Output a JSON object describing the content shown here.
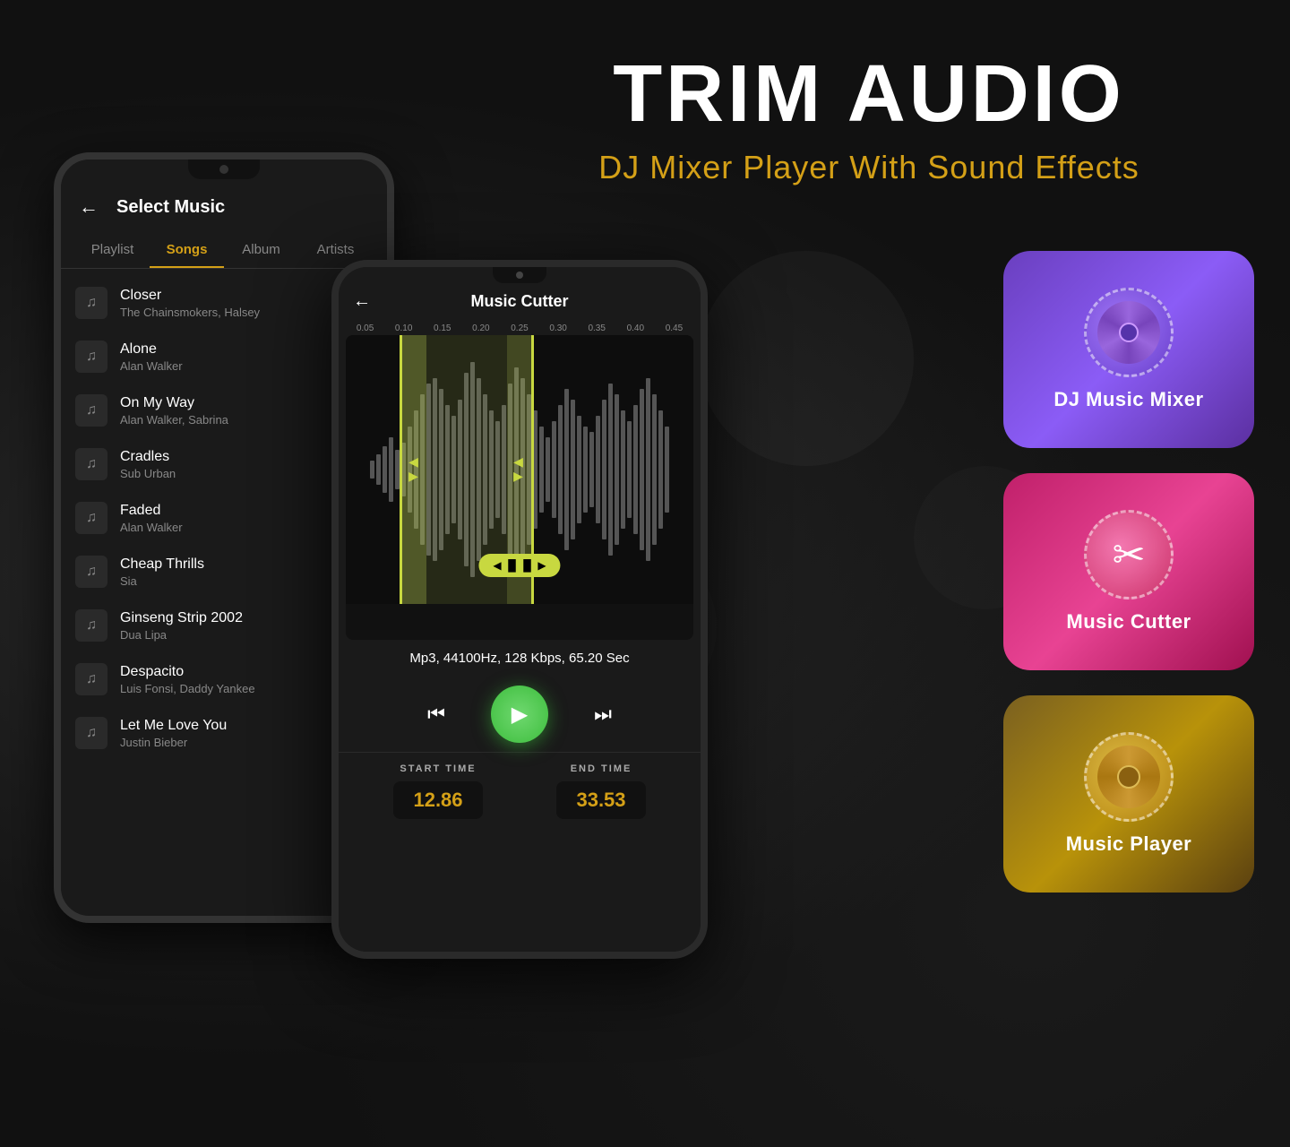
{
  "page": {
    "background": "#111111"
  },
  "header": {
    "main_title": "TRIM AUDIO",
    "sub_title": "DJ Mixer Player With Sound Effects"
  },
  "phone1": {
    "back_arrow": "←",
    "title": "Select Music",
    "tabs": [
      {
        "label": "Playlist",
        "active": false
      },
      {
        "label": "Songs",
        "active": true
      },
      {
        "label": "Album",
        "active": false
      },
      {
        "label": "Artists",
        "active": false
      }
    ],
    "songs": [
      {
        "name": "Closer",
        "artist": "The Chainsmokers, Halsey"
      },
      {
        "name": "Alone",
        "artist": "Alan Walker"
      },
      {
        "name": "On My Way",
        "artist": "Alan Walker, Sabrina"
      },
      {
        "name": "Cradles",
        "artist": "Sub Urban"
      },
      {
        "name": "Faded",
        "artist": "Alan Walker"
      },
      {
        "name": "Cheap Thrills",
        "artist": "Sia"
      },
      {
        "name": "Ginseng Strip 2002",
        "artist": "Dua Lipa"
      },
      {
        "name": "Despacito",
        "artist": "Luis Fonsi, Daddy Yankee"
      },
      {
        "name": "Let Me Love You",
        "artist": "Justin Bieber"
      }
    ]
  },
  "phone2": {
    "back_arrow": "←",
    "title": "Music Cutter",
    "timeline_labels": [
      "0.05",
      "0.10",
      "0.15",
      "0.20",
      "0.25",
      "0.30",
      "0.35",
      "0.40",
      "0.45"
    ],
    "file_info": "Mp3, 44100Hz, 128 Kbps, 65.20 Sec",
    "start_time_label": "START TIME",
    "end_time_label": "END TIME",
    "start_time_value": "12.86",
    "end_time_value": "33.53",
    "waveform_bars": [
      8,
      14,
      22,
      30,
      18,
      25,
      40,
      55,
      70,
      80,
      85,
      75,
      60,
      50,
      65,
      90,
      100,
      85,
      70,
      55,
      45,
      60,
      80,
      95,
      85,
      70,
      55,
      40,
      30,
      45,
      60,
      75,
      65,
      50,
      40,
      35,
      50,
      65,
      80,
      70,
      55,
      45,
      60,
      75,
      85,
      70,
      55,
      40
    ]
  },
  "app_cards": [
    {
      "id": "dj-mixer",
      "label": "DJ Music Mixer",
      "icon_type": "vinyl",
      "gradient": "dj"
    },
    {
      "id": "music-cutter",
      "label": "Music Cutter",
      "icon_type": "scissors",
      "gradient": "cutter"
    },
    {
      "id": "music-player",
      "label": "Music Player",
      "icon_type": "record",
      "gradient": "player"
    }
  ]
}
